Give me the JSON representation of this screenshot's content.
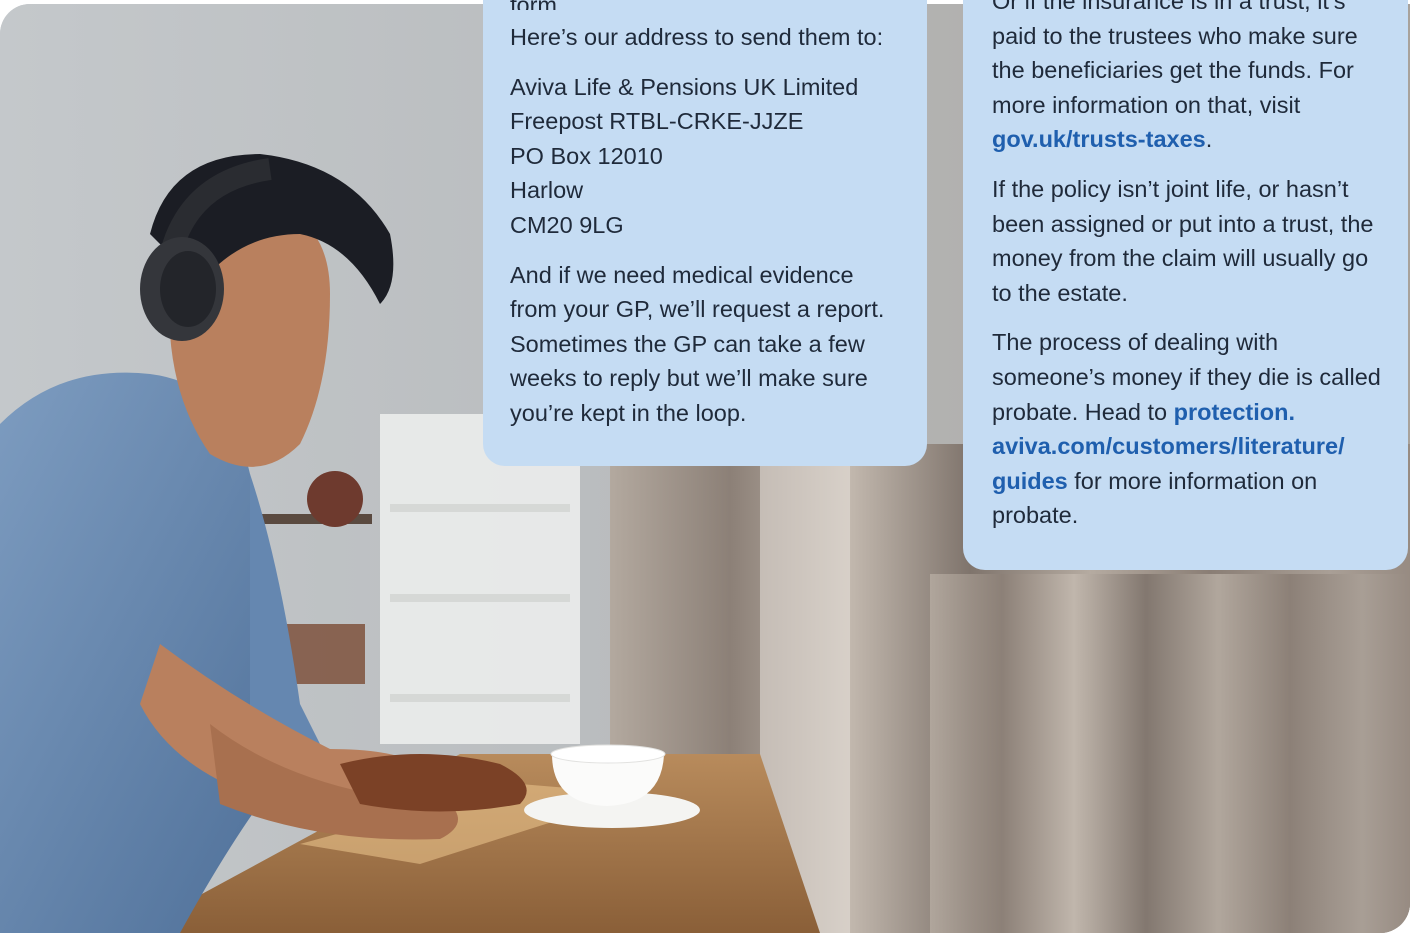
{
  "middle_card": {
    "cut_line": "form,",
    "intro": "Here’s our address to send them to:",
    "address": [
      "Aviva Life & Pensions UK Limited",
      "Freepost RTBL-CRKE-JJZE",
      "PO Box 12010",
      "Harlow",
      "CM20 9LG"
    ],
    "medical": "And if we need medical evidence from your GP, we’ll request a report. Sometimes the GP can take a few weeks to reply but we’ll make sure you’re kept in the loop."
  },
  "right_card": {
    "trust_text": "Or if the insurance is in a trust, it’s paid to the trustees who make sure the beneficiaries get the funds. For more information on that, visit",
    "trust_link": "gov.uk/trusts-taxes",
    "trust_end": ".",
    "estate_text": "If the policy isn’t joint life, or hasn’t been assigned or put into a trust, the money from the claim will usually go to the estate.",
    "probate_text": "The process of dealing with someone’s money if they die is called probate. Head to",
    "probate_link": "protection. aviva.com/customers/literature/ guides",
    "probate_end": "for more information on probate."
  },
  "colors": {
    "card_background": "#c5dcf3",
    "link": "#1f5fae",
    "body_text": "#1f2a3a"
  }
}
